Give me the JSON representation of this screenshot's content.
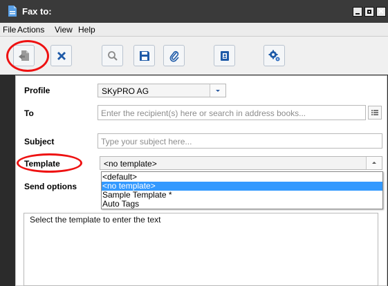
{
  "window": {
    "title": "Fax to:",
    "icon": "fax-doc-icon",
    "controls": [
      "minimize-icon",
      "maximize-icon",
      "close-icon"
    ],
    "close_glyph": "✕"
  },
  "menu": [
    "File",
    "Actions",
    "View",
    "Help"
  ],
  "toolbar": {
    "buttons": [
      {
        "name": "send-button",
        "icon": "send-doc-icon",
        "highlighted": true
      },
      {
        "name": "cancel-button",
        "icon": "close-x-icon"
      },
      {
        "name": "search-button",
        "icon": "search-icon"
      },
      {
        "name": "save-button",
        "icon": "save-icon"
      },
      {
        "name": "attach-button",
        "icon": "paperclip-icon"
      },
      {
        "name": "address-book-button",
        "icon": "contact-card-icon"
      },
      {
        "name": "settings-button",
        "icon": "gears-icon"
      }
    ]
  },
  "form": {
    "profile": {
      "label": "Profile",
      "value": "SKyPRO AG"
    },
    "to": {
      "label": "To",
      "placeholder": "Enter the recipient(s) here or search in address books..."
    },
    "subject": {
      "label": "Subject",
      "placeholder": "Type your subject here..."
    },
    "template": {
      "label": "Template",
      "value": "<no template>",
      "highlighted": true,
      "options": [
        "<default>",
        "<no template>",
        "Sample Template *",
        "Auto Tags"
      ],
      "selected_index": 1
    },
    "send_options": {
      "label": "Send options"
    }
  },
  "body_hint": "Select the template to enter the text",
  "colors": {
    "titlebar": "#3a3a3a",
    "accent": "#1e5aa8",
    "highlight": "#ee1111",
    "selection": "#3399ff"
  }
}
